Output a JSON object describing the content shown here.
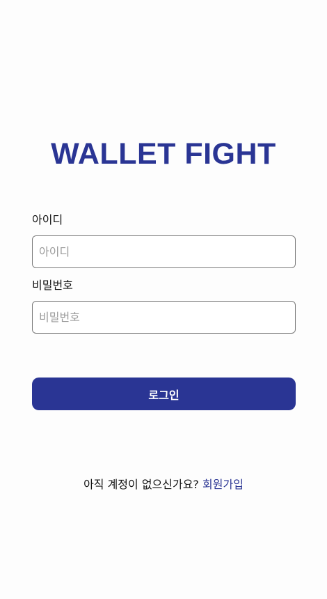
{
  "app": {
    "title": "WALLET FIGHT"
  },
  "login_form": {
    "id_label": "아이디",
    "id_placeholder": "아이디",
    "id_value": "",
    "password_label": "비밀번호",
    "password_placeholder": "비밀번호",
    "password_value": "",
    "submit_label": "로그인"
  },
  "signup": {
    "prompt_text": "아직 계정이 없으신가요?",
    "link_label": "회원가입"
  },
  "colors": {
    "brand": "#2a3594",
    "background": "#fdfdfd",
    "input_border": "#7a7a7a",
    "placeholder": "#9a9a9a"
  }
}
